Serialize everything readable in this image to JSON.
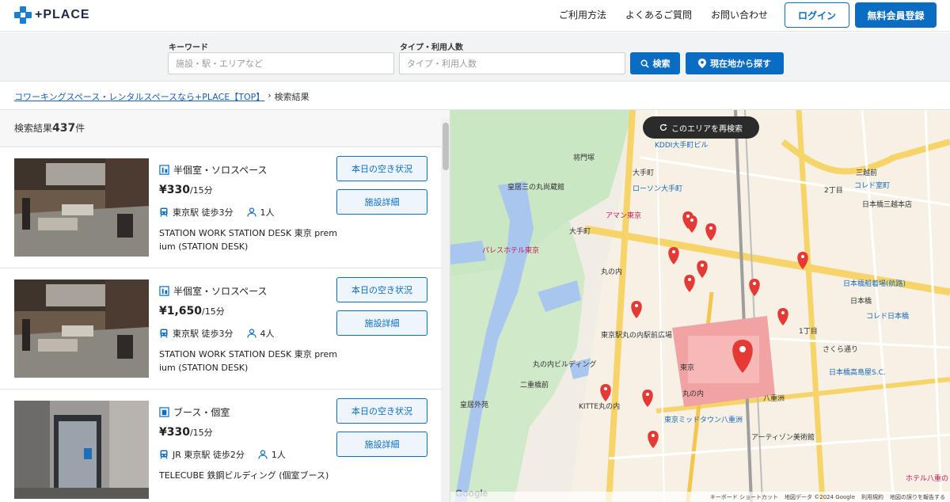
{
  "header": {
    "logo_text": "+PLACE",
    "nav": [
      "ご利用方法",
      "よくあるご質問",
      "お問い合わせ"
    ],
    "login_label": "ログイン",
    "register_label": "無料会員登録"
  },
  "search": {
    "keyword_label": "キーワード",
    "keyword_placeholder": "施設・駅・エリアなど",
    "type_label": "タイプ・利用人数",
    "type_placeholder": "タイプ・利用人数",
    "search_button": "検索",
    "locate_button": "現在地から探す"
  },
  "breadcrumb": {
    "home": "コワーキングスペース・レンタルスペースなら+PLACE【TOP】",
    "separator": "›",
    "current": "検索結果"
  },
  "results": {
    "count_prefix": "検索結果",
    "count": "437",
    "count_suffix": "件",
    "cards": [
      {
        "type": "半個室・ソロスペース",
        "price": "¥330",
        "price_unit": "/15分",
        "access": "東京駅 徒歩3分",
        "capacity": "1人",
        "name": "STATION WORK STATION DESK 東京 premium (STATION DESK)",
        "availability_button": "本日の空き状況",
        "detail_button": "施設詳細"
      },
      {
        "type": "半個室・ソロスペース",
        "price": "¥1,650",
        "price_unit": "/15分",
        "access": "東京駅 徒歩3分",
        "capacity": "4人",
        "name": "STATION WORK STATION DESK 東京 premium (STATION DESK)",
        "availability_button": "本日の空き状況",
        "detail_button": "施設詳細"
      },
      {
        "type": "ブース・個室",
        "price": "¥330",
        "price_unit": "/15分",
        "access": "JR 東京駅 徒歩2分",
        "capacity": "1人",
        "name": "TELECUBE 鉄鋼ビルディング (個室ブース)",
        "availability_button": "本日の空き状況",
        "detail_button": "施設詳細"
      }
    ]
  },
  "map": {
    "reload_label": "このエリアを再検索",
    "labels": [
      "大手町",
      "皇居三の丸尚蔵館",
      "ローソン大手町",
      "アマン東京",
      "大手町",
      "パレスホテル東京",
      "丸の内",
      "東京駅丸の内駅前広場",
      "丸の内ビルディング",
      "二重橋前",
      "皇居外苑",
      "KITTE丸の内",
      "丸の内",
      "東京",
      "東京ミッドタウン八重洲",
      "アーティゾン美術館",
      "日本橋三越本店",
      "三越前",
      "コレド室町",
      "日本橋",
      "日本橋高島屋S.C.",
      "コレド日本橋",
      "さくら通り",
      "八重洲",
      "1丁目",
      "2丁目",
      "ホテル八重の",
      "日本橋船着場(航路)",
      "KDDI大手町ビル",
      "将門塚"
    ],
    "google": "Google",
    "footer": [
      "キーボード ショートカット",
      "地図データ ©2024 Google",
      "利用規約",
      "地図の誤りを報告する"
    ]
  },
  "colors": {
    "brand": "#0a6dc2",
    "pin": "#e53935"
  }
}
